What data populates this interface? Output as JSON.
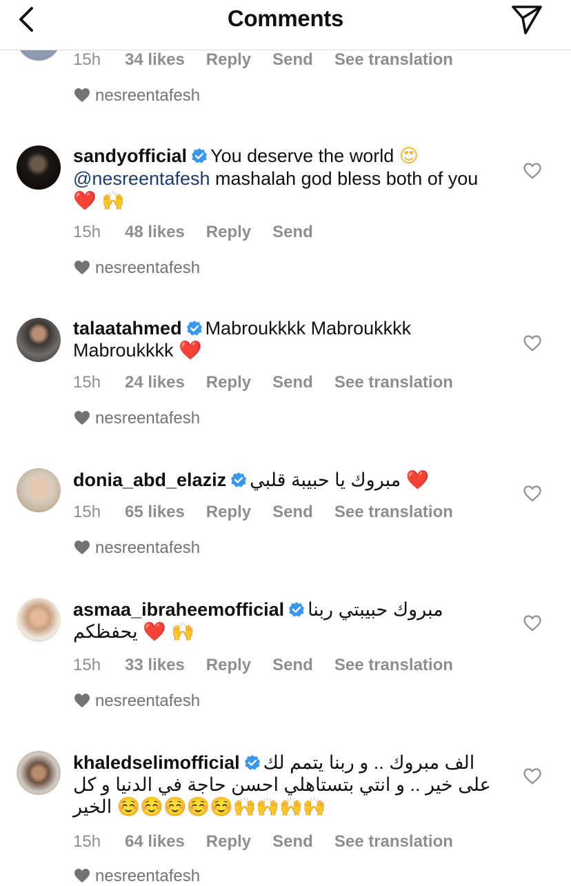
{
  "header": {
    "title": "Comments"
  },
  "meta_labels": {
    "reply": "Reply",
    "send": "Send",
    "see_translation": "See translation"
  },
  "liked_by": "nesreentafesh",
  "partial_comment": {
    "time": "15h",
    "likes": "34 likes"
  },
  "comments": [
    {
      "username": "sandyofficial",
      "text1": "You deserve the world",
      "emoji1": "😍",
      "mention": "@nesreentafesh",
      "text2": " mashalah god bless both of you",
      "emoji2": "❤️",
      "emoji3": "🙌",
      "time": "15h",
      "likes": "48 likes"
    },
    {
      "username": "talaatahmed",
      "text1": "Mabroukkkk Mabroukkkk Mabroukkkk",
      "emoji1": "❤️",
      "time": "15h",
      "likes": "24 likes"
    },
    {
      "username": "donia_abd_elaziz",
      "text1": "مبروك يا حبيبة قلبي",
      "emoji1": "❤️",
      "time": "15h",
      "likes": "65 likes"
    },
    {
      "username": "asmaa_ibraheemofficial",
      "text1": "مبروك حبيبتي ربنا يحفظكم",
      "emoji1": "❤️",
      "emoji2": "🙌",
      "time": "15h",
      "likes": "33 likes"
    },
    {
      "username": "khaledselimofficial",
      "text1": "الف مبروك .. و ربنا يتمم لك على خير .. و انتي بتستاهلي احسن حاجة في الدنيا و كل الخير",
      "emoji1": "☺️☺️☺️☺️☺️",
      "emoji2": "🙌🙌🙌🙌",
      "time": "15h",
      "likes": "64 likes"
    }
  ]
}
